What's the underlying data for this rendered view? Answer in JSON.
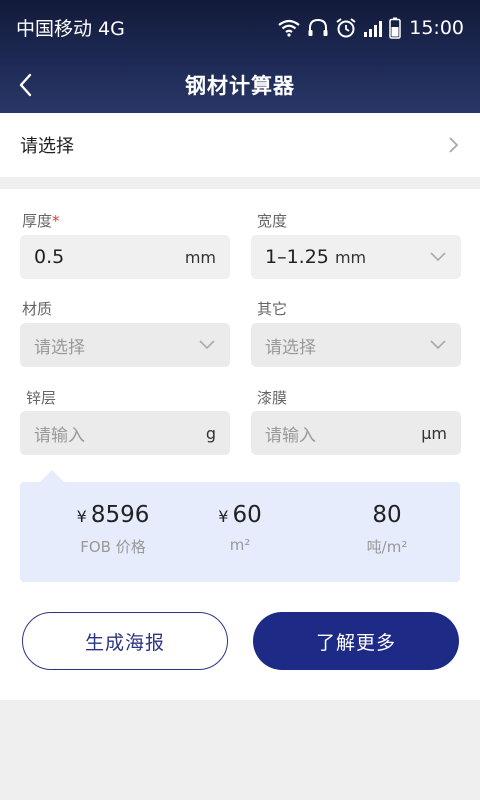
{
  "status": {
    "carrier": "中国移动 4G",
    "time": "15:00"
  },
  "header": {
    "title": "钢材计算器"
  },
  "selector": {
    "label": "请选择"
  },
  "form": {
    "thickness": {
      "label": "厚度",
      "required_mark": "*",
      "value": "0.5",
      "unit": "mm"
    },
    "width": {
      "label": "宽度",
      "value": "1–1.25",
      "unit": "mm"
    },
    "material": {
      "label": "材质",
      "placeholder": "请选择"
    },
    "other": {
      "label": "其它",
      "placeholder": "请选择"
    },
    "zinc": {
      "label": "锌层",
      "placeholder": "请输入",
      "unit": "g"
    },
    "film": {
      "label": "漆膜",
      "placeholder": "请输入",
      "unit": "μm"
    }
  },
  "result": {
    "currency": "¥",
    "price": {
      "value": "8596",
      "label": "FOB 价格"
    },
    "area": {
      "value": "60",
      "label": "m²"
    },
    "density": {
      "value": "80",
      "label": "吨/m²"
    }
  },
  "buttons": {
    "poster": "生成海报",
    "more": "了解更多"
  },
  "colors": {
    "header_dark": "#121a3a",
    "accent": "#1d2a86",
    "result_bg": "#e6ecfb",
    "required": "#e53935"
  }
}
